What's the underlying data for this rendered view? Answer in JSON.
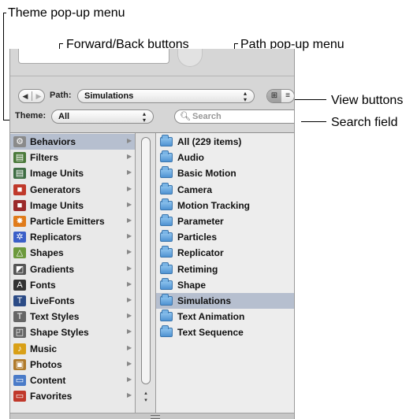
{
  "callouts": {
    "theme_popup": "Theme pop-up menu",
    "forward_back": "Forward/Back buttons",
    "path_popup": "Path pop-up menu",
    "view_buttons": "View buttons",
    "search_field": "Search field"
  },
  "toolbar": {
    "path_label": "Path:",
    "path_value": "Simulations",
    "theme_label": "Theme:",
    "theme_value": "All",
    "search_placeholder": "Search",
    "back_glyph": "◀",
    "forward_glyph": "▶",
    "view_icons_glyph": "⊞",
    "view_list_glyph": "≡",
    "popup_arrows": "▴\n▾"
  },
  "sidebar": {
    "items": [
      {
        "label": "Behaviors",
        "icon": "gear-icon",
        "glyph": "⚙",
        "color": "#8a8a8a",
        "selected": true
      },
      {
        "label": "Filters",
        "icon": "filters-icon",
        "glyph": "▤",
        "color": "#4b7a3a"
      },
      {
        "label": "Image Units",
        "icon": "image-units-icon",
        "glyph": "▤",
        "color": "#3f6e44"
      },
      {
        "label": "Generators",
        "icon": "generators-icon",
        "glyph": "■",
        "color": "#c0392b"
      },
      {
        "label": "Image Units",
        "icon": "image-units-icon",
        "glyph": "■",
        "color": "#9b2a2a"
      },
      {
        "label": "Particle Emitters",
        "icon": "particle-emitters-icon",
        "glyph": "✸",
        "color": "#e07b1a"
      },
      {
        "label": "Replicators",
        "icon": "replicators-icon",
        "glyph": "✲",
        "color": "#3a5fc8"
      },
      {
        "label": "Shapes",
        "icon": "shapes-icon",
        "glyph": "△",
        "color": "#6c9a3c"
      },
      {
        "label": "Gradients",
        "icon": "gradients-icon",
        "glyph": "◩",
        "color": "#555"
      },
      {
        "label": "Fonts",
        "icon": "fonts-icon",
        "glyph": "A",
        "color": "#333"
      },
      {
        "label": "LiveFonts",
        "icon": "livefonts-icon",
        "glyph": "T",
        "color": "#2b4b86"
      },
      {
        "label": "Text Styles",
        "icon": "text-styles-icon",
        "glyph": "T",
        "color": "#666"
      },
      {
        "label": "Shape Styles",
        "icon": "shape-styles-icon",
        "glyph": "◰",
        "color": "#666"
      },
      {
        "label": "Music",
        "icon": "music-icon",
        "glyph": "♪",
        "color": "#d9a017"
      },
      {
        "label": "Photos",
        "icon": "photos-icon",
        "glyph": "▣",
        "color": "#b07a2a"
      },
      {
        "label": "Content",
        "icon": "content-icon",
        "glyph": "▭",
        "color": "#4a7bc8"
      },
      {
        "label": "Favorites",
        "icon": "favorites-icon",
        "glyph": "▭",
        "color": "#c0392b"
      }
    ],
    "arrow_glyph": "▶"
  },
  "folders": {
    "items": [
      {
        "label": "All (229 items)"
      },
      {
        "label": "Audio"
      },
      {
        "label": "Basic Motion"
      },
      {
        "label": "Camera"
      },
      {
        "label": "Motion Tracking"
      },
      {
        "label": "Parameter"
      },
      {
        "label": "Particles"
      },
      {
        "label": "Replicator"
      },
      {
        "label": "Retiming"
      },
      {
        "label": "Shape"
      },
      {
        "label": "Simulations",
        "selected": true
      },
      {
        "label": "Text Animation"
      },
      {
        "label": "Text Sequence"
      }
    ]
  },
  "scrollbar": {
    "up_arrow": "▴",
    "down_arrow": "▾"
  }
}
